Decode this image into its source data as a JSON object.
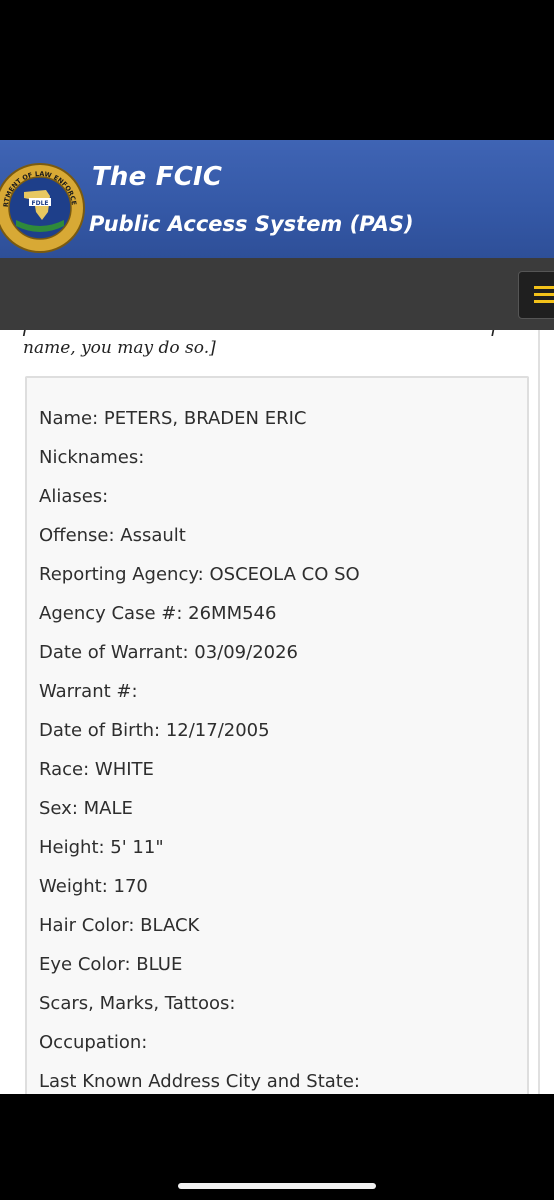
{
  "header": {
    "title": "The FCIC",
    "subtitle": "Public Access System (PAS)",
    "logo_icon": "fdle-seal-icon",
    "seal_text_top": "DEPARTMENT OF LAW ENFORCEMENT",
    "seal_text_center": "FDLE"
  },
  "nav": {
    "menu_icon": "hamburger-menu-icon",
    "accent_color": "#f3c21a"
  },
  "intro_text": "name, you may do so.]",
  "record": {
    "name": "Name: PETERS, BRADEN ERIC",
    "nicknames": "Nicknames:",
    "aliases": "Aliases:",
    "offense": "Offense: Assault",
    "reporting_agency": "Reporting Agency: OSCEOLA CO SO",
    "agency_case": "Agency Case #: 26MM546",
    "date_of_warrant": "Date of Warrant: 03/09/2026",
    "warrant_number": "Warrant #:",
    "date_of_birth": "Date of Birth: 12/17/2005",
    "race": "Race: WHITE",
    "sex": "Sex: MALE",
    "height": "Height: 5' 11\"",
    "weight": "Weight: 170",
    "hair_color": "Hair Color: BLACK",
    "eye_color": "Eye Color: BLUE",
    "scars": "Scars, Marks, Tattoos:",
    "occupation": "Occupation:",
    "last_known_address": "Last Known Address City and State:"
  },
  "colors": {
    "header_blue": "#3458a6",
    "navbar": "#3b3b3b",
    "card_bg": "#f8f8f8"
  }
}
